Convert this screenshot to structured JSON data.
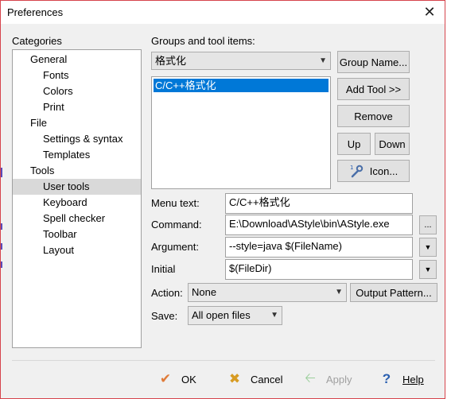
{
  "window": {
    "title": "Preferences",
    "close_glyph": "✕"
  },
  "categories": {
    "label": "Categories",
    "items": [
      {
        "label": "General",
        "level": 0
      },
      {
        "label": "Fonts",
        "level": 1
      },
      {
        "label": "Colors",
        "level": 1
      },
      {
        "label": "Print",
        "level": 1
      },
      {
        "label": "File",
        "level": 0
      },
      {
        "label": "Settings & syntax",
        "level": 1
      },
      {
        "label": "Templates",
        "level": 1
      },
      {
        "label": "Tools",
        "level": 0
      },
      {
        "label": "User tools",
        "level": 1,
        "selected": true
      },
      {
        "label": "Keyboard",
        "level": 1
      },
      {
        "label": "Spell checker",
        "level": 1
      },
      {
        "label": "Toolbar",
        "level": 1
      },
      {
        "label": "Layout",
        "level": 1
      }
    ]
  },
  "groups": {
    "label": "Groups and tool items:",
    "selected_group": "格式化",
    "tool_items": [
      "C/C++格式化"
    ]
  },
  "buttons": {
    "group_name": "Group Name...",
    "add_tool": "Add Tool >>",
    "remove": "Remove",
    "up": "Up",
    "down": "Down",
    "icon": "Icon..."
  },
  "form": {
    "menu_text_label": "Menu text:",
    "menu_text_value": "C/C++格式化",
    "command_label": "Command:",
    "command_value": "E:\\Download\\AStyle\\bin\\AStyle.exe",
    "browse_label": "...",
    "argument_label": "Argument:",
    "argument_value": "--style=java $(FileName)",
    "initial_label": "Initial",
    "initial_value": "$(FileDir)",
    "action_label": "Action:",
    "action_value": "None",
    "output_pattern": "Output Pattern...",
    "save_label": "Save:",
    "save_value": "All open files"
  },
  "footer": {
    "ok": "OK",
    "cancel": "Cancel",
    "apply": "Apply",
    "help": "Help"
  },
  "colors": {
    "selection": "#0078d7",
    "ok_icon": "#e07b39",
    "cancel_icon": "#d79b22",
    "help_icon": "#2a5fb0",
    "window_border": "#d6444c"
  }
}
